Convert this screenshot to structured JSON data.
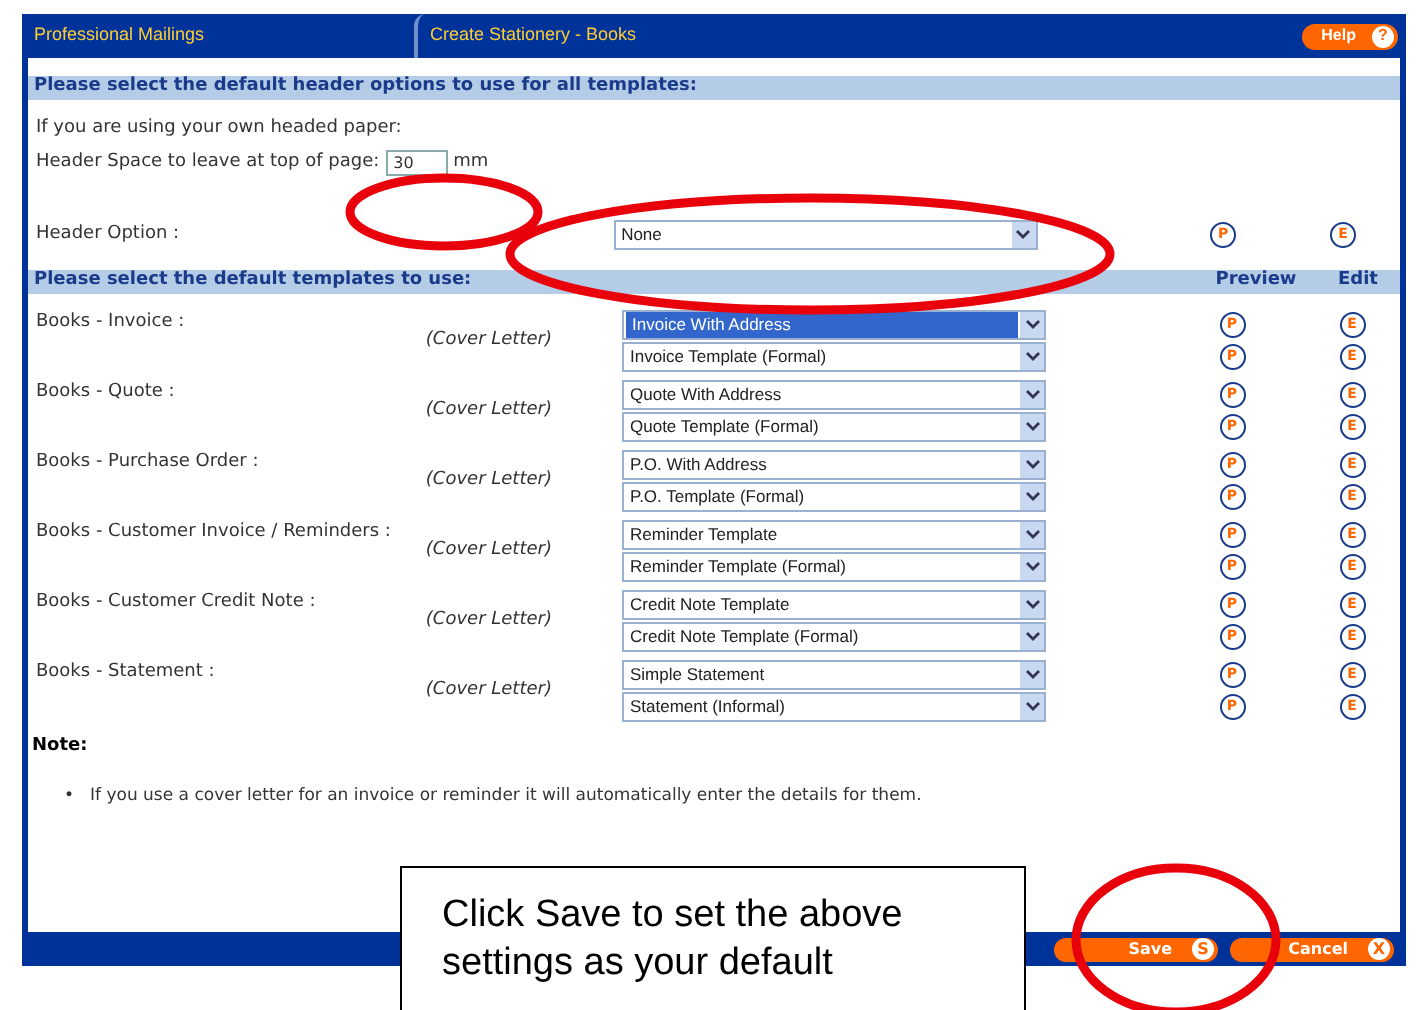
{
  "tabs": [
    {
      "label": "Professional Mailings",
      "selected": false
    },
    {
      "label": "Create Stationery - Books",
      "selected": true
    }
  ],
  "help_button": {
    "label": "Help",
    "icon": "?"
  },
  "header_section": {
    "heading": "Please select the default header options to use for all templates:",
    "intro": "If you are using your own headed paper:",
    "space_label": "Header Space to leave at top of page:",
    "space_value": "30",
    "space_unit": "mm",
    "option_label": "Header Option :",
    "option_value": "None",
    "preview": "P",
    "edit": "E"
  },
  "templates_section": {
    "heading": "Please select the default templates to use:",
    "columns": [
      "Preview",
      "Edit"
    ],
    "groups": [
      {
        "label": "Books - Invoice :",
        "cover_label": "(Cover Letter)",
        "selects": [
          {
            "value": "Invoice With Address",
            "highlighted": true,
            "preview": "P",
            "edit": "E"
          },
          {
            "value": "Invoice Template (Formal)",
            "highlighted": false,
            "preview": "P",
            "edit": "E"
          }
        ]
      },
      {
        "label": "Books - Quote :",
        "cover_label": "(Cover Letter)",
        "selects": [
          {
            "value": "Quote With Address",
            "highlighted": false,
            "preview": "P",
            "edit": "E"
          },
          {
            "value": "Quote Template (Formal)",
            "highlighted": false,
            "preview": "P",
            "edit": "E"
          }
        ]
      },
      {
        "label": "Books - Purchase Order :",
        "cover_label": "(Cover Letter)",
        "selects": [
          {
            "value": "P.O. With Address",
            "highlighted": false,
            "preview": "P",
            "edit": "E"
          },
          {
            "value": "P.O. Template (Formal)",
            "highlighted": false,
            "preview": "P",
            "edit": "E"
          }
        ]
      },
      {
        "label": "Books - Customer Invoice / Reminders :",
        "cover_label": "(Cover Letter)",
        "selects": [
          {
            "value": "Reminder Template",
            "highlighted": false,
            "preview": "P",
            "edit": "E"
          },
          {
            "value": "Reminder Template (Formal)",
            "highlighted": false,
            "preview": "P",
            "edit": "E"
          }
        ]
      },
      {
        "label": "Books - Customer Credit Note :",
        "cover_label": "(Cover Letter)",
        "selects": [
          {
            "value": "Credit Note Template",
            "highlighted": false,
            "preview": "P",
            "edit": "E"
          },
          {
            "value": "Credit Note Template (Formal)",
            "highlighted": false,
            "preview": "P",
            "edit": "E"
          }
        ]
      },
      {
        "label": "Books - Statement :",
        "cover_label": "(Cover Letter)",
        "selects": [
          {
            "value": "Simple Statement",
            "highlighted": false,
            "preview": "P",
            "edit": "E"
          },
          {
            "value": "Statement (Informal)",
            "highlighted": false,
            "preview": "P",
            "edit": "E"
          }
        ]
      }
    ]
  },
  "note": {
    "heading": "Note:",
    "bullet": "•",
    "items": [
      "If you use a cover letter for an invoice or reminder it will automatically enter the details for them."
    ]
  },
  "buttons": [
    {
      "label": "Save",
      "icon": "S"
    },
    {
      "label": "Cancel",
      "icon": "X"
    }
  ],
  "callout": "Click Save to set the above settings as your default"
}
